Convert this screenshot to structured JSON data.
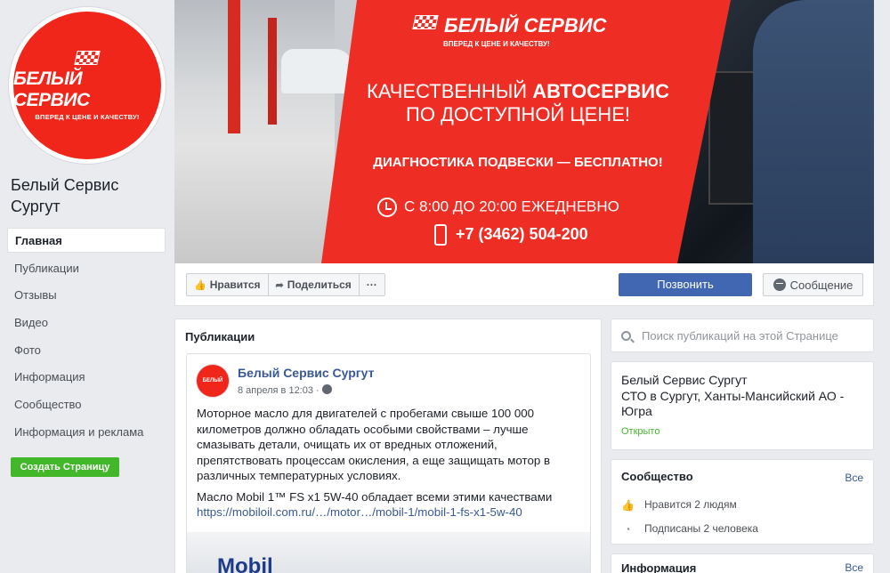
{
  "avatar": {
    "brand": "БЕЛЫЙ СЕРВИС",
    "slogan": "ВПЕРЕД К ЦЕНЕ И КАЧЕСТВУ!"
  },
  "page": {
    "name": "Белый Сервис Сургут"
  },
  "nav": {
    "items": [
      "Главная",
      "Публикации",
      "Отзывы",
      "Видео",
      "Фото",
      "Информация",
      "Сообщество",
      "Информация и реклама"
    ],
    "create_page": "Создать Страницу"
  },
  "cover": {
    "logo_brand": "БЕЛЫЙ СЕРВИС",
    "logo_slogan": "ВПЕРЕД К ЦЕНЕ И КАЧЕСТВУ!",
    "headline_part1": "КАЧЕСТВЕННЫЙ ",
    "headline_bold": "АВТОСЕРВИС",
    "headline_line2": "ПО ДОСТУПНОЙ ЦЕНЕ!",
    "subheadline": "ДИАГНОСТИКА ПОДВЕСКИ — БЕСПЛАТНО!",
    "hours": "С 8:00 ДО 20:00 ЕЖЕДНЕВНО",
    "phone": "+7 (3462) 504-200"
  },
  "actions": {
    "like": "Нравится",
    "share": "Поделиться",
    "more": "···",
    "call": "Позвонить",
    "message": "Сообщение"
  },
  "posts": {
    "title": "Публикации",
    "post": {
      "author": "Белый Сервис Сургут",
      "avatar_text": "БЕЛЫЙ СЕРВИС",
      "date": "8 апреля в 12:03 ·",
      "paragraph1": "Моторное масло для двигателей с пробегами свыше 100 000 километров должно обладать особыми свойствами – лучше смазывать детали, очищать их от вредных отложений, препятствовать процессам окисления, а еще защищать мотор в различных температурных условиях.",
      "paragraph2": "Масло Mobil 1™ FS x1 5W-40 обладает всеми этими качествами",
      "link": "https://mobiloil.com.ru/…/motor…/mobil-1/mobil-1-fs-x1-5w-40",
      "image_brand": "Mobil"
    }
  },
  "sidebar": {
    "search_placeholder": "Поиск публикаций на этой Странице",
    "about": {
      "name": "Белый Сервис Сургут",
      "category": "СТО в Сургут, Ханты-Мансийский АО - Югра",
      "status": "Открыто"
    },
    "community": {
      "title": "Сообщество",
      "see_all": "Все",
      "likes": "Нравится 2 людям",
      "follows": "Подписаны 2 человека"
    },
    "info": {
      "title": "Информация",
      "see_all": "Все"
    }
  },
  "colors": {
    "brand_red": "#ee2e24",
    "facebook_blue": "#4267b2",
    "green": "#42b72a",
    "link": "#385898"
  }
}
